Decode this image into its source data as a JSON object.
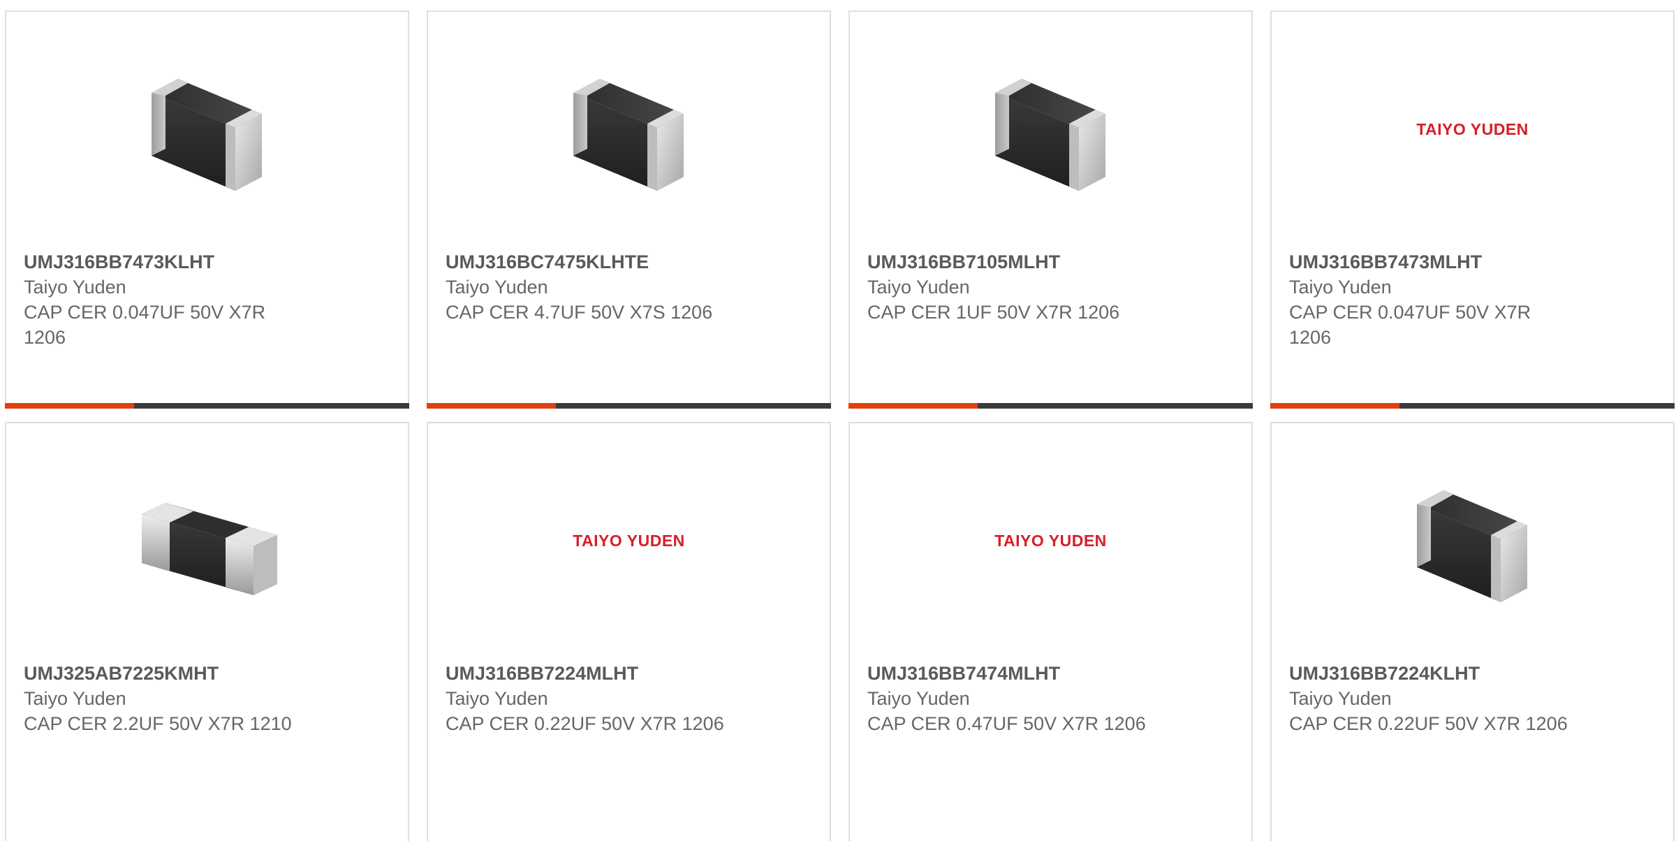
{
  "products": [
    {
      "part_number": "UMJ316BB7473KLHT",
      "manufacturer": "Taiyo Yuden",
      "description": "CAP CER 0.047UF 50V X7R 1206",
      "image": "chip-capacitor-angled",
      "progress": 0.32
    },
    {
      "part_number": "UMJ316BC7475KLHTE",
      "manufacturer": "Taiyo Yuden",
      "description": "CAP CER 4.7UF 50V X7S 1206",
      "image": "chip-capacitor-angled",
      "progress": 0.32
    },
    {
      "part_number": "UMJ316BB7105MLHT",
      "manufacturer": "Taiyo Yuden",
      "description": "CAP CER 1UF 50V X7R 1206",
      "image": "chip-capacitor-angled",
      "progress": 0.32
    },
    {
      "part_number": "UMJ316BB7473MLHT",
      "manufacturer": "Taiyo Yuden",
      "description": "CAP CER 0.047UF 50V X7R 1206",
      "image": "taiyo-yuden-logo",
      "logo_text": "TAIYO YUDEN",
      "progress": 0.32
    },
    {
      "part_number": "UMJ325AB7225KMHT",
      "manufacturer": "Taiyo Yuden",
      "description": "CAP CER 2.2UF 50V X7R 1210",
      "image": "chip-capacitor-flat"
    },
    {
      "part_number": "UMJ316BB7224MLHT",
      "manufacturer": "Taiyo Yuden",
      "description": "CAP CER 0.22UF 50V X7R 1206",
      "image": "taiyo-yuden-logo",
      "logo_text": "TAIYO YUDEN"
    },
    {
      "part_number": "UMJ316BB7474MLHT",
      "manufacturer": "Taiyo Yuden",
      "description": "CAP CER 0.47UF 50V X7R 1206",
      "image": "taiyo-yuden-logo",
      "logo_text": "TAIYO YUDEN"
    },
    {
      "part_number": "UMJ316BB7224KLHT",
      "manufacturer": "Taiyo Yuden",
      "description": "CAP CER 0.22UF 50V X7R 1206",
      "image": "chip-capacitor-angled"
    }
  ],
  "colors": {
    "accent": "#e2400d",
    "track": "#3b3b3b",
    "logo_red": "#d81e27",
    "card_border": "#dedede",
    "text_bold": "#5a5a5a",
    "text": "#666666"
  }
}
